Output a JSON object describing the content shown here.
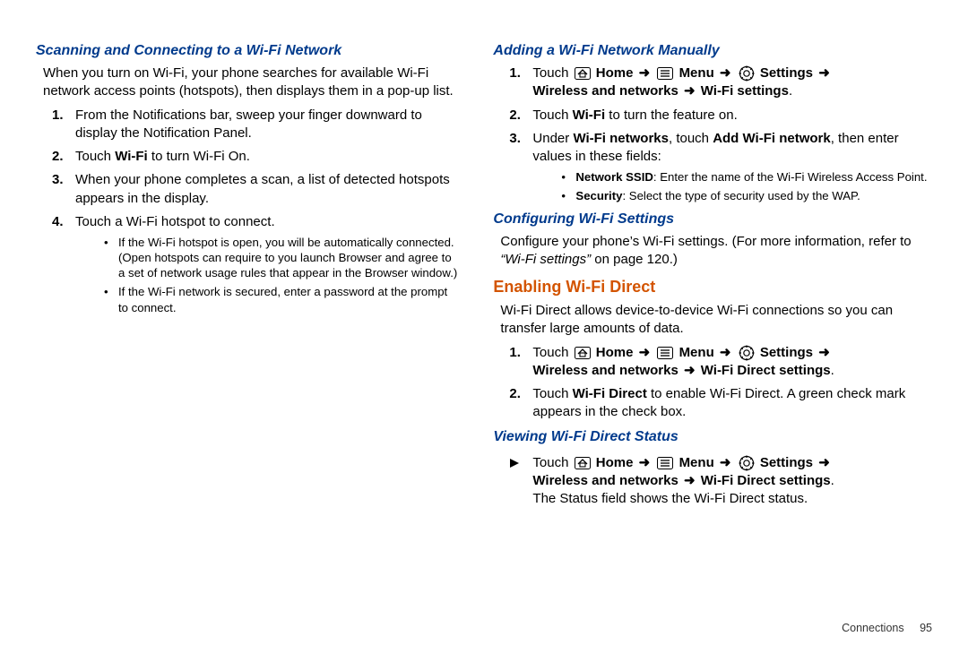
{
  "footer": {
    "section": "Connections",
    "page": "95"
  },
  "icons": {
    "home": "Home",
    "menu": "Menu",
    "settings": "Settings"
  },
  "arrow": "➜",
  "left": {
    "h_scan": "Scanning and Connecting to a Wi-Fi Network",
    "p_intro": "When you turn on Wi-Fi, your phone searches for available Wi-Fi network access points (hotspots), then displays them in a pop-up list.",
    "s1": "From the Notifications bar, sweep your finger downward to display the Notification Panel.",
    "s2_a": "Touch ",
    "s2_b": "Wi-Fi",
    "s2_c": " to turn Wi-Fi On.",
    "s3": "When your phone completes a scan, a list of detected hotspots appears in the display.",
    "s4": "Touch a Wi-Fi hotspot to connect.",
    "b1": "If the Wi-Fi hotspot is open, you will be automatically connected. (Open hotspots can require to you launch Browser and agree to a set of network usage rules that appear in the Browser window.)",
    "b2": "If the Wi-Fi network is secured, enter a password at the prompt to connect."
  },
  "right": {
    "h_add": "Adding a Wi-Fi Network Manually",
    "add_s1_touch": "Touch ",
    "add_s1_tail1": "Wireless and networks ",
    "add_s1_tail2": " Wi-Fi settings",
    "add_s2_a": "Touch ",
    "add_s2_b": "Wi-Fi",
    "add_s2_c": " to turn the feature on.",
    "add_s3_a": "Under ",
    "add_s3_b": "Wi-Fi networks",
    "add_s3_c": ", touch ",
    "add_s3_d": "Add Wi-Fi network",
    "add_s3_e": ", then enter values in these fields:",
    "add_b1_a": "Network SSID",
    "add_b1_b": ": Enter the name of the Wi-Fi Wireless Access Point.",
    "add_b2_a": "Security",
    "add_b2_b": ": Select the type of security used by the WAP.",
    "h_conf": "Configuring Wi-Fi Settings",
    "conf_a": "Configure your phone’s Wi-Fi settings. (For more information, refer to ",
    "conf_b": "“Wi-Fi settings”",
    "conf_c": " on page 120.)",
    "h_enable": "Enabling Wi-Fi Direct",
    "en_p": "Wi-Fi Direct allows device-to-device Wi-Fi connections so you can transfer large amounts of data.",
    "en_s1_tail2": " Wi-Fi Direct settings",
    "en_s2_a": "Touch ",
    "en_s2_b": "Wi-Fi Direct",
    "en_s2_c": " to enable Wi-Fi Direct. A green check mark appears in the check box.",
    "h_view": "Viewing Wi-Fi Direct Status",
    "view_tail": "The Status field shows the Wi-Fi Direct status."
  },
  "nums": {
    "n1": "1.",
    "n2": "2.",
    "n3": "3.",
    "n4": "4."
  },
  "period": "."
}
